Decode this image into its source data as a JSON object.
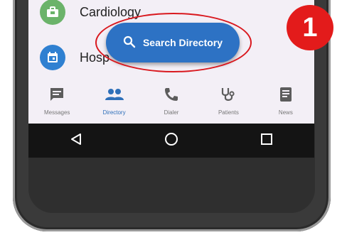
{
  "list": {
    "items": [
      {
        "label": "Cardiology",
        "icon": "briefcase-icon",
        "color": "#6bb36a"
      },
      {
        "label": "Hosp",
        "icon": "calendar-icon",
        "color": "#2f80d1"
      }
    ]
  },
  "fab": {
    "label": "Search Directory",
    "icon": "search-icon",
    "color": "#2d72c4"
  },
  "nav": {
    "items": [
      {
        "label": "Messages",
        "icon": "message-icon"
      },
      {
        "label": "Directory",
        "icon": "people-icon",
        "active": true
      },
      {
        "label": "Dialer",
        "icon": "phone-icon"
      },
      {
        "label": "Patients",
        "icon": "stethoscope-icon"
      },
      {
        "label": "News",
        "icon": "news-icon"
      }
    ]
  },
  "system_nav": {
    "buttons": [
      "back-icon",
      "home-icon",
      "recents-icon"
    ]
  },
  "annotation": {
    "number": "1",
    "color": "#e31b1b"
  }
}
